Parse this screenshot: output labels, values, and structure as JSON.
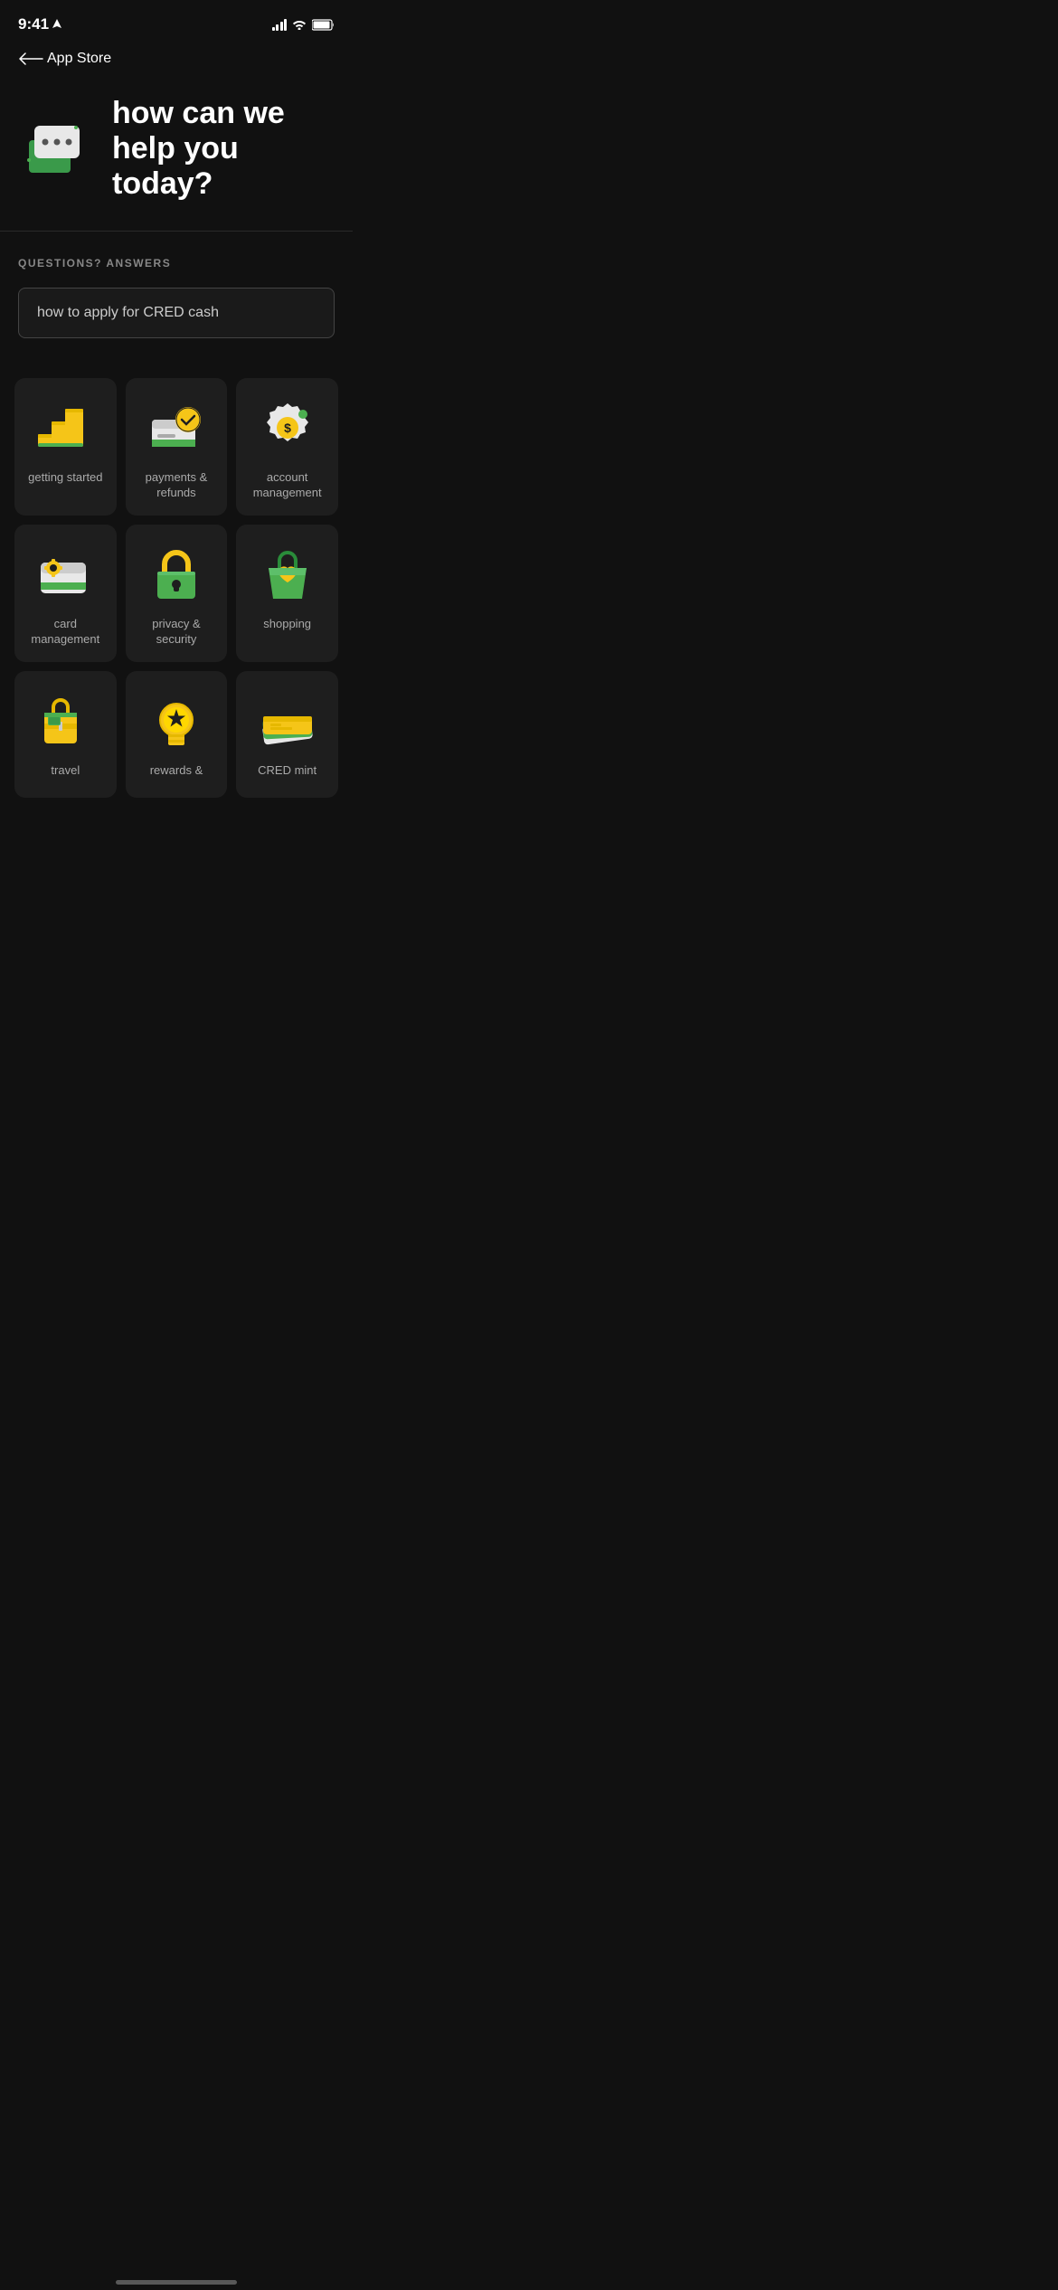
{
  "status_bar": {
    "time": "9:41",
    "nav_back": "App Store"
  },
  "nav": {
    "back_label": "←"
  },
  "hero": {
    "title": "how can we help you today?",
    "icon_name": "help-chat-icon"
  },
  "questions_section": {
    "label": "QUESTIONS? ANSWERS",
    "search_placeholder": "how to apply for CRED cash"
  },
  "categories": [
    {
      "id": "getting-started",
      "label": "getting started",
      "icon": "steps-icon"
    },
    {
      "id": "payments-refunds",
      "label": "payments & refunds",
      "icon": "payment-check-icon"
    },
    {
      "id": "account-management",
      "label": "account management",
      "icon": "account-badge-icon"
    },
    {
      "id": "card-management",
      "label": "card management",
      "icon": "card-gear-icon"
    },
    {
      "id": "privacy-security",
      "label": "privacy & security",
      "icon": "lock-icon"
    },
    {
      "id": "shopping",
      "label": "shopping",
      "icon": "shopping-bag-icon"
    },
    {
      "id": "travel",
      "label": "travel",
      "icon": "travel-icon"
    },
    {
      "id": "rewards",
      "label": "rewards &",
      "icon": "rewards-icon"
    },
    {
      "id": "cred-mint",
      "label": "CRED mint",
      "icon": "cred-mint-icon"
    }
  ],
  "colors": {
    "background": "#111111",
    "card_background": "#1e1e1e",
    "green": "#4caf50",
    "yellow": "#f5c518",
    "gold": "#ffd700",
    "text_primary": "#ffffff",
    "text_secondary": "#aaaaaa",
    "text_muted": "#888888",
    "border": "#444444"
  }
}
